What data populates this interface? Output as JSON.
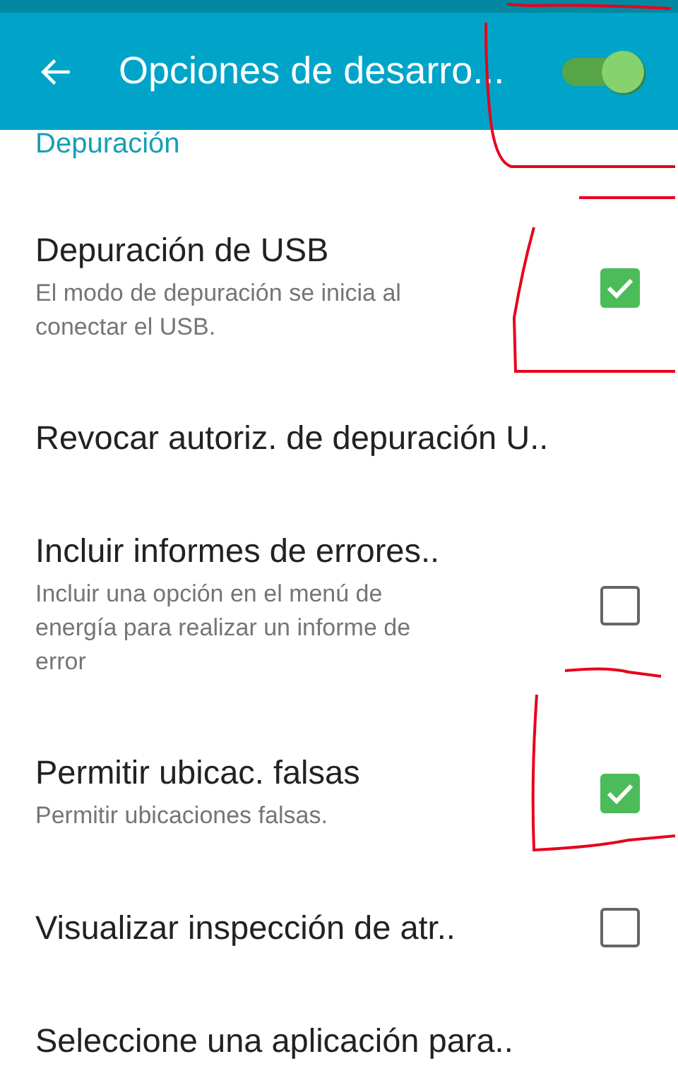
{
  "app_bar": {
    "title": "Opciones de desarro...",
    "toggle": {
      "on": true
    }
  },
  "section_header": "Depuración",
  "settings": [
    {
      "kind": "checkbox",
      "title": "Depuración de USB",
      "summary": "El modo de depuración se inicia al conectar el USB.",
      "checked": true
    },
    {
      "kind": "action",
      "title": "Revocar autoriz. de depuración U.."
    },
    {
      "kind": "checkbox",
      "title": "Incluir informes de errores..",
      "summary": "Incluir una opción en el menú de energía para realizar un informe de error",
      "checked": false
    },
    {
      "kind": "checkbox",
      "title": "Permitir ubicac. falsas",
      "summary": "Permitir ubicaciones falsas.",
      "checked": true
    },
    {
      "kind": "checkbox",
      "title": "Visualizar inspección de atr..",
      "checked": false
    },
    {
      "kind": "action",
      "title": "Seleccione una aplicación para.."
    }
  ]
}
